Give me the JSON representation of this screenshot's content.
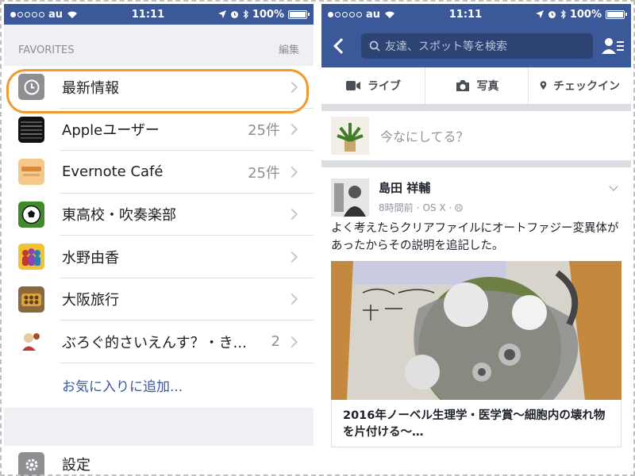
{
  "left": {
    "status": {
      "carrier": "au",
      "time": "11:11",
      "battery": "100%"
    },
    "favorites_label": "FAVORITES",
    "edit_label": "編集",
    "items": [
      {
        "label": "最新情報",
        "count": "",
        "icon": "clock-icon"
      },
      {
        "label": "Appleユーザー",
        "count": "25件",
        "icon": "group-photo-icon"
      },
      {
        "label": "Evernote Café",
        "count": "25件",
        "icon": "group-photo-icon"
      },
      {
        "label": "東高校・吹奏楽部",
        "count": "",
        "icon": "soccer-ball-icon"
      },
      {
        "label": "水野由香",
        "count": "",
        "icon": "people-icon"
      },
      {
        "label": "大阪旅行",
        "count": "",
        "icon": "food-photo-icon"
      },
      {
        "label": "ぶろぐ的さいえんす？・き...",
        "count": "2",
        "icon": "blog-photo-icon"
      }
    ],
    "add_favorite": "お気に入りに追加...",
    "settings_label": "設定"
  },
  "right": {
    "status": {
      "carrier": "au",
      "time": "11:11",
      "battery": "100%"
    },
    "search_placeholder": "友達、スポット等を検索",
    "actions": {
      "live": "ライブ",
      "photo": "写真",
      "checkin": "チェックイン"
    },
    "composer_placeholder": "今なにしてる？",
    "post": {
      "author": "島田 祥輔",
      "time": "8時間前",
      "source": "OS X",
      "text": "よく考えたらクリアファイルにオートファジー変異体があったからその説明を追記した。",
      "link_title": "2016年ノーベル生理学・医学賞〜細胞内の壊れ物を片付ける〜…"
    }
  }
}
